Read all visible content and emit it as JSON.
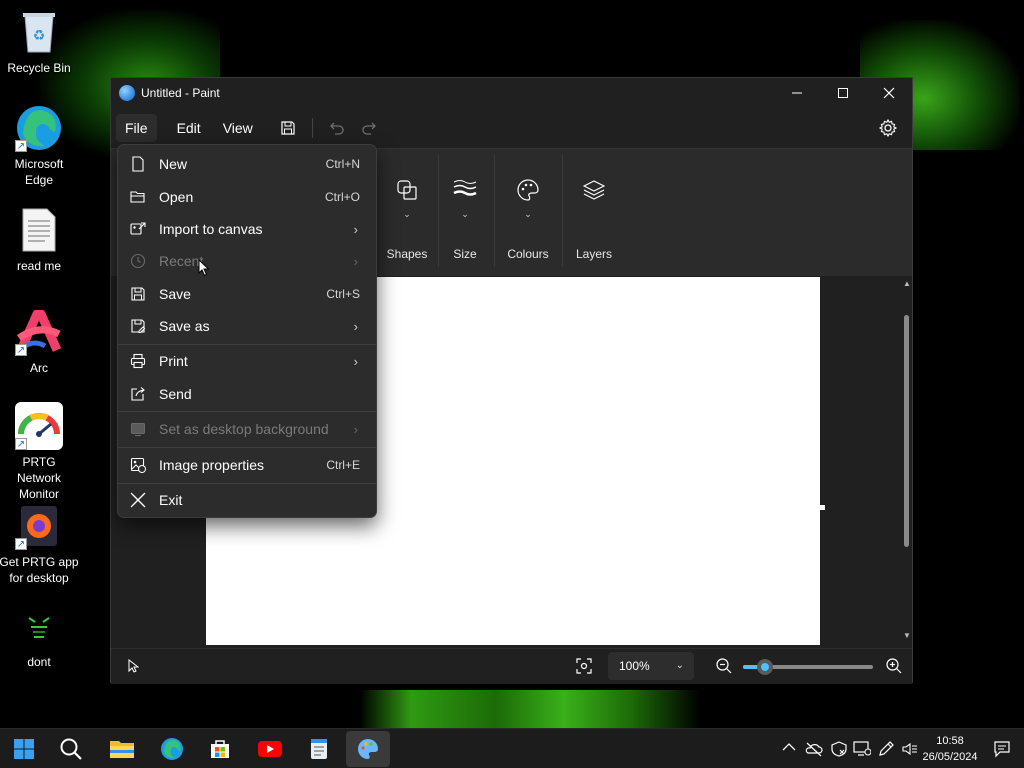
{
  "desktop": {
    "icons": [
      {
        "label": "Recycle Bin",
        "icon": "recycle-bin-icon"
      },
      {
        "label": "Microsoft Edge",
        "icon": "edge-icon"
      },
      {
        "label": "read me",
        "icon": "text-document-icon"
      },
      {
        "label": "Arc",
        "icon": "arc-browser-icon"
      },
      {
        "label": "PRTG Network Monitor",
        "icon": "prtg-gauge-icon"
      },
      {
        "label": "Get PRTG app for desktop",
        "icon": "firefox-icon"
      },
      {
        "label": "dont",
        "icon": "hacker-image-icon"
      }
    ]
  },
  "window": {
    "title": "Untitled - Paint",
    "controls": {
      "minimize": "minimize-icon",
      "maximize": "maximize-icon",
      "close": "close-icon"
    }
  },
  "menubar": {
    "file": "File",
    "edit": "Edit",
    "view": "View"
  },
  "ribbon": {
    "shapes": "Shapes",
    "size": "Size",
    "colours": "Colours",
    "layers": "Layers"
  },
  "file_menu": {
    "items": [
      {
        "label": "New",
        "shortcut": "Ctrl+N",
        "icon": "new-file-icon"
      },
      {
        "label": "Open",
        "shortcut": "Ctrl+O",
        "icon": "folder-open-icon"
      },
      {
        "label": "Import to canvas",
        "icon": "import-image-icon",
        "submenu": true
      },
      {
        "label": "Recent",
        "icon": "clock-icon",
        "submenu": true,
        "disabled": true
      },
      {
        "label": "Save",
        "shortcut": "Ctrl+S",
        "icon": "save-icon"
      },
      {
        "label": "Save as",
        "icon": "save-as-icon",
        "submenu": true
      },
      {
        "label": "Print",
        "icon": "printer-icon",
        "submenu": true
      },
      {
        "label": "Send",
        "icon": "share-icon"
      },
      {
        "label": "Set as desktop background",
        "icon": "desktop-background-icon",
        "submenu": true,
        "disabled": true
      },
      {
        "label": "Image properties",
        "shortcut": "Ctrl+E",
        "icon": "image-properties-icon"
      },
      {
        "label": "Exit",
        "icon": "exit-icon"
      }
    ]
  },
  "statusbar": {
    "zoom": "100%",
    "zoom_level": 0.17
  },
  "taskbar": {
    "apps": [
      "start-icon",
      "search-icon",
      "file-explorer-icon",
      "edge-icon",
      "microsoft-store-icon",
      "youtube-icon",
      "notepad-icon",
      "paint-icon"
    ],
    "time": "10:58",
    "date": "26/05/2024"
  },
  "colors": {
    "accent": "#4cc2ff",
    "menu_bg": "#2c2c2c",
    "window_bg": "#202020"
  }
}
